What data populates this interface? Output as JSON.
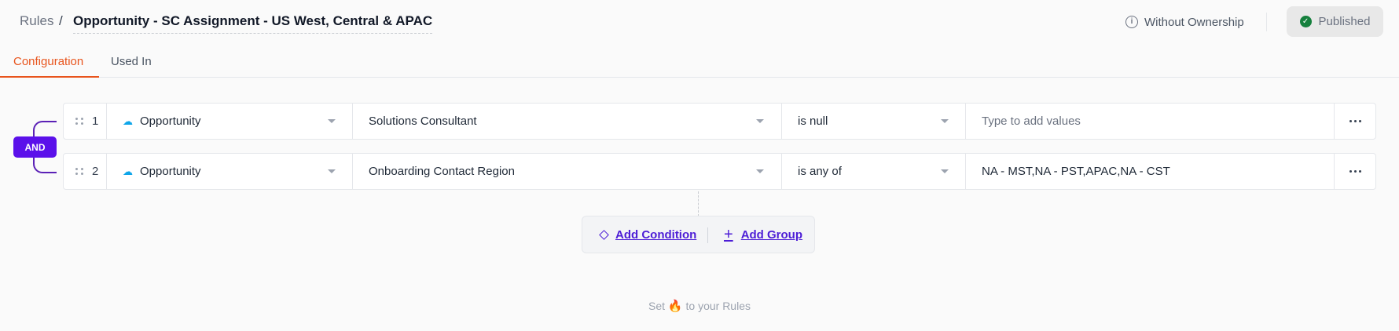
{
  "header": {
    "breadcrumb_root": "Rules",
    "breadcrumb_sep": "/",
    "title": "Opportunity - SC Assignment - US West, Central & APAC",
    "ownership_label": "Without Ownership",
    "status_label": "Published"
  },
  "tabs": [
    {
      "label": "Configuration",
      "active": true
    },
    {
      "label": "Used In",
      "active": false
    }
  ],
  "logic": {
    "operator": "AND"
  },
  "rules": [
    {
      "index": "1",
      "object": "Opportunity",
      "object_icon": "salesforce-cloud-icon",
      "field": "Solutions Consultant",
      "operator": "is null",
      "values": "",
      "values_placeholder": "Type to add values"
    },
    {
      "index": "2",
      "object": "Opportunity",
      "object_icon": "salesforce-cloud-icon",
      "field": "Onboarding Contact Region",
      "operator": "is any of",
      "values": "NA - MST,NA - PST,APAC,NA - CST",
      "values_placeholder": ""
    }
  ],
  "actions": {
    "add_condition": "Add Condition",
    "add_group": "Add Group"
  },
  "footer": {
    "prefix": "Set",
    "suffix": "to your Rules",
    "icon": "fire-icon"
  },
  "colors": {
    "accent_tab": "#e8541c",
    "logic_purple": "#5b10ea",
    "link_purple": "#4c1dd6",
    "published_green": "#15803d"
  }
}
